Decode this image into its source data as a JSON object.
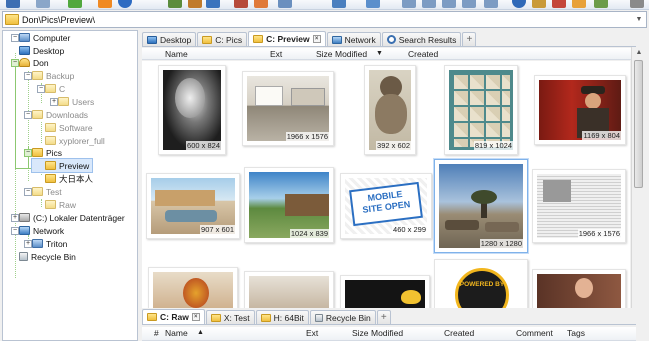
{
  "address": {
    "path": "Don\\Pics\\Preview\\"
  },
  "tree": [
    {
      "label": "Computer",
      "icon": "computer-icon"
    },
    {
      "label": "Desktop",
      "icon": "desktop-icon"
    },
    {
      "label": "Don",
      "icon": "user-folder-icon"
    },
    {
      "label": "Backup",
      "icon": "folder-icon"
    },
    {
      "label": "C",
      "icon": "folder-icon"
    },
    {
      "label": "Users",
      "icon": "folder-icon"
    },
    {
      "label": "Downloads",
      "icon": "folder-icon"
    },
    {
      "label": "Software",
      "icon": "folder-icon"
    },
    {
      "label": "xyplorer_full",
      "icon": "folder-icon"
    },
    {
      "label": "Pics",
      "icon": "folder-icon"
    },
    {
      "label": "Preview",
      "icon": "folder-icon"
    },
    {
      "label": "大日本人",
      "icon": "folder-icon"
    },
    {
      "label": "Test",
      "icon": "folder-icon"
    },
    {
      "label": "Raw",
      "icon": "folder-icon"
    },
    {
      "label": "(C:) Lokaler Datenträger",
      "icon": "drive-icon"
    },
    {
      "label": "Network",
      "icon": "network-icon"
    },
    {
      "label": "Triton",
      "icon": "computer-icon"
    },
    {
      "label": "Recycle Bin",
      "icon": "recycle-bin-icon"
    }
  ],
  "top_tabs": [
    {
      "label": "Desktop",
      "icon": "desktop-icon",
      "active": false
    },
    {
      "label": "C: Pics",
      "icon": "folder-icon",
      "active": false
    },
    {
      "label": "C: Preview",
      "icon": "folder-icon",
      "active": true
    },
    {
      "label": "Network",
      "icon": "network-icon",
      "active": false
    },
    {
      "label": "Search Results",
      "icon": "search-icon",
      "active": false
    }
  ],
  "top_columns": {
    "name": "Name",
    "ext": "Ext",
    "size": "Size",
    "modified": "Modified",
    "created": "Created",
    "sort_glyph": "▼"
  },
  "thumbnails": [
    {
      "dims": "600 x 824",
      "subject": "portrait-bw"
    },
    {
      "dims": "1966 x 1576",
      "subject": "room-interior"
    },
    {
      "dims": "392 x 602",
      "subject": "sumo-wrestler"
    },
    {
      "dims": "819 x 1024",
      "subject": "icon-grid"
    },
    {
      "dims": "1169 x 804",
      "subject": "man-in-hat"
    },
    {
      "dims": "907 x 601",
      "subject": "vintage-car-motel"
    },
    {
      "dims": "1024 x 839",
      "subject": "pier-landscape"
    },
    {
      "dims": "460 x 299",
      "subject": "mobile-site-open"
    },
    {
      "dims": "1280 x 1280",
      "subject": "cars-sky"
    },
    {
      "dims": "1966 x 1576",
      "subject": "newspaper"
    },
    {
      "dims": "",
      "subject": "parrot"
    },
    {
      "dims": "",
      "subject": "desk"
    },
    {
      "dims": "",
      "subject": "toucan"
    },
    {
      "dims": "",
      "subject": "badge"
    },
    {
      "dims": "",
      "subject": "woman"
    }
  ],
  "thumb_texts": {
    "mobile_line1": "MOBILE",
    "mobile_line2": "SITE OPEN",
    "badge_text": "POWERED BY"
  },
  "bottom_tabs": [
    {
      "label": "C: Raw",
      "icon": "folder-icon",
      "active": true
    },
    {
      "label": "X: Test",
      "icon": "folder-icon",
      "active": false
    },
    {
      "label": "H: 64Bit",
      "icon": "folder-icon",
      "active": false
    },
    {
      "label": "Recycle Bin",
      "icon": "recycle-bin-icon",
      "active": false
    }
  ],
  "bottom_columns": {
    "hash": "#",
    "name": "Name",
    "sort_glyph": "▲",
    "ext": "Ext",
    "size": "Size",
    "modified": "Modified",
    "created": "Created",
    "comment": "Comment",
    "tags": "Tags"
  },
  "colors": {
    "selection": "#d9e8fb",
    "tree_line": "#8cc870",
    "folder": "#f0c040"
  }
}
